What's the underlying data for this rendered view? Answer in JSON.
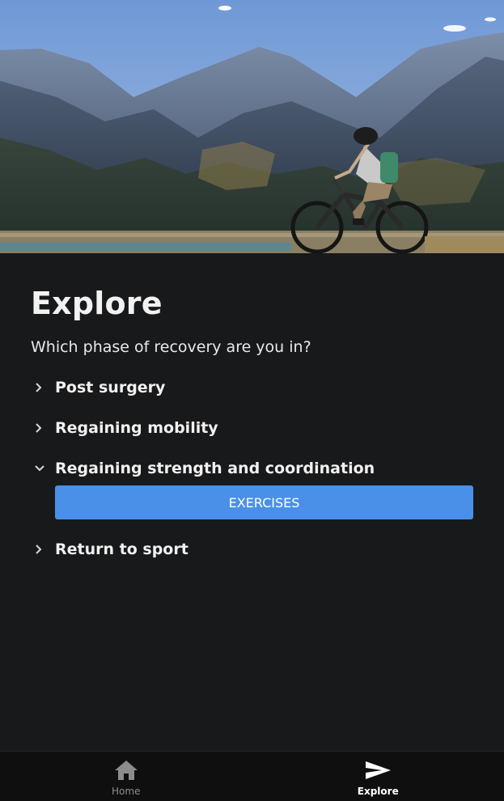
{
  "hero": {
    "icon": "mountain-biker-landscape-image"
  },
  "main": {
    "title": "Explore",
    "question": "Which phase of recovery are you in?",
    "phases": [
      {
        "label": "Post surgery",
        "expanded": false
      },
      {
        "label": "Regaining mobility",
        "expanded": false
      },
      {
        "label": "Regaining strength and coordination",
        "expanded": true,
        "action_label": "EXERCISES"
      },
      {
        "label": "Return to sport",
        "expanded": false
      }
    ]
  },
  "nav": {
    "items": [
      {
        "label": "Home",
        "icon": "home-icon",
        "active": false
      },
      {
        "label": "Explore",
        "icon": "send-icon",
        "active": true
      }
    ]
  },
  "colors": {
    "background": "#18191b",
    "accent": "#4a90e8",
    "nav_background": "#0f0f10"
  }
}
